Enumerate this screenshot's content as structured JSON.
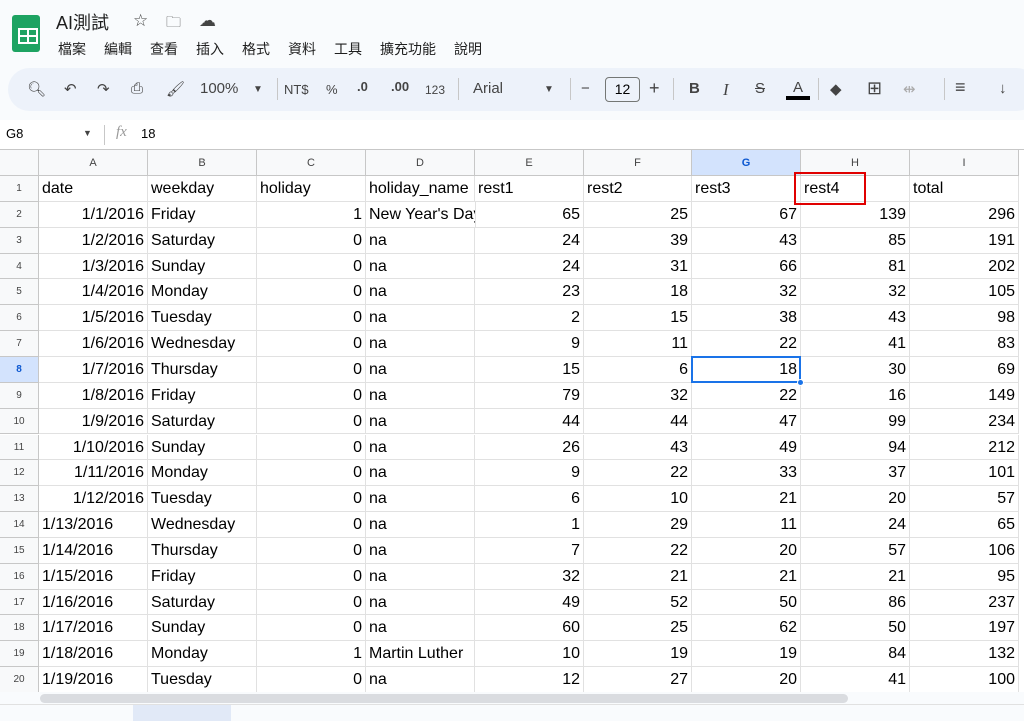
{
  "app": {
    "title": "AI測試",
    "menu": [
      "檔案",
      "編輯",
      "查看",
      "插入",
      "格式",
      "資料",
      "工具",
      "擴充功能",
      "說明"
    ]
  },
  "toolbar": {
    "zoom": "100%",
    "currency": "NT$",
    "percent": "%",
    "dec_decrease": ".0",
    "dec_increase": ".00",
    "number_format": "123",
    "font": "Arial",
    "font_size": "12",
    "minus": "−",
    "plus": "+",
    "bold": "B",
    "italic": "I",
    "text_color": "A"
  },
  "formula_bar": {
    "cell_ref": "G8",
    "fx": "fx",
    "value": "18"
  },
  "columns": [
    "A",
    "B",
    "C",
    "D",
    "E",
    "F",
    "G",
    "H",
    "I"
  ],
  "selected": {
    "column": "G",
    "row": 8
  },
  "highlight_cell": "H1",
  "rows": [
    [
      "date",
      "weekday",
      "holiday",
      "holiday_name",
      "rest1",
      "rest2",
      "rest3",
      "rest4",
      "total"
    ],
    [
      "1/1/2016",
      "Friday",
      "1",
      "New Year's Day",
      "65",
      "25",
      "67",
      "139",
      "296"
    ],
    [
      "1/2/2016",
      "Saturday",
      "0",
      "na",
      "24",
      "39",
      "43",
      "85",
      "191"
    ],
    [
      "1/3/2016",
      "Sunday",
      "0",
      "na",
      "24",
      "31",
      "66",
      "81",
      "202"
    ],
    [
      "1/4/2016",
      "Monday",
      "0",
      "na",
      "23",
      "18",
      "32",
      "32",
      "105"
    ],
    [
      "1/5/2016",
      "Tuesday",
      "0",
      "na",
      "2",
      "15",
      "38",
      "43",
      "98"
    ],
    [
      "1/6/2016",
      "Wednesday",
      "0",
      "na",
      "9",
      "11",
      "22",
      "41",
      "83"
    ],
    [
      "1/7/2016",
      "Thursday",
      "0",
      "na",
      "15",
      "6",
      "18",
      "30",
      "69"
    ],
    [
      "1/8/2016",
      "Friday",
      "0",
      "na",
      "79",
      "32",
      "22",
      "16",
      "149"
    ],
    [
      "1/9/2016",
      "Saturday",
      "0",
      "na",
      "44",
      "44",
      "47",
      "99",
      "234"
    ],
    [
      "1/10/2016",
      "Sunday",
      "0",
      "na",
      "26",
      "43",
      "49",
      "94",
      "212"
    ],
    [
      "1/11/2016",
      "Monday",
      "0",
      "na",
      "9",
      "22",
      "33",
      "37",
      "101"
    ],
    [
      "1/12/2016",
      "Tuesday",
      "0",
      "na",
      "6",
      "10",
      "21",
      "20",
      "57"
    ],
    [
      "1/13/2016",
      "Wednesday",
      "0",
      "na",
      "1",
      "29",
      "11",
      "24",
      "65"
    ],
    [
      "1/14/2016",
      "Thursday",
      "0",
      "na",
      "7",
      "22",
      "20",
      "57",
      "106"
    ],
    [
      "1/15/2016",
      "Friday",
      "0",
      "na",
      "32",
      "21",
      "21",
      "21",
      "95"
    ],
    [
      "1/16/2016",
      "Saturday",
      "0",
      "na",
      "49",
      "52",
      "50",
      "86",
      "237"
    ],
    [
      "1/17/2016",
      "Sunday",
      "0",
      "na",
      "60",
      "25",
      "62",
      "50",
      "197"
    ],
    [
      "1/18/2016",
      "Monday",
      "1",
      "Martin Luther",
      "10",
      "19",
      "19",
      "84",
      "132"
    ],
    [
      "1/19/2016",
      "Tuesday",
      "0",
      "na",
      "12",
      "27",
      "20",
      "41",
      "100"
    ]
  ],
  "left_aligned_dates_from_row": 14
}
